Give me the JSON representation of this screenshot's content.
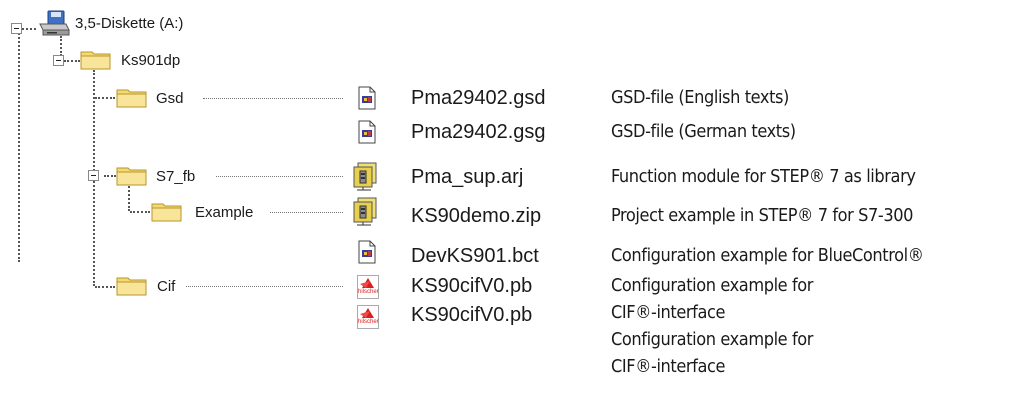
{
  "tree": {
    "drive": "3,5-Diskette (A:)",
    "root_folder": "Ks901dp",
    "folders": {
      "gsd": "Gsd",
      "s7fb": "S7_fb",
      "example": "Example",
      "cif": "Cif"
    }
  },
  "files": [
    {
      "name": "Pma29402.gsd",
      "desc": "GSD-file (English texts)",
      "icon": "document-icon"
    },
    {
      "name": "Pma29402.gsg",
      "desc": "GSD-file (German texts)",
      "icon": "document-icon"
    },
    {
      "name": "Pma_sup.arj",
      "desc": "Function module for STEP® 7 as library",
      "icon": "archive-icon"
    },
    {
      "name": "KS90demo.zip",
      "desc": "Project example in STEP® 7 for S7-300",
      "icon": "archive-icon"
    },
    {
      "name": "DevKS901.bct",
      "desc": "Configuration example for BlueControl®",
      "icon": "document-icon"
    },
    {
      "name": "KS90cifV0.pb",
      "desc_line1": "Configuration example for",
      "desc_line2": "CIF®-interface",
      "icon": "hilscher-icon"
    },
    {
      "name": "KS90cifV0.pb",
      "desc_line1": "Configuration example for",
      "desc_line2": "CIF®-interface",
      "icon": "hilscher-icon"
    }
  ],
  "icon_brand_text": "hilscher",
  "colors": {
    "folder": "#f3da72",
    "folder_edge": "#b8952a",
    "hilscher_red": "#d81e1e"
  }
}
